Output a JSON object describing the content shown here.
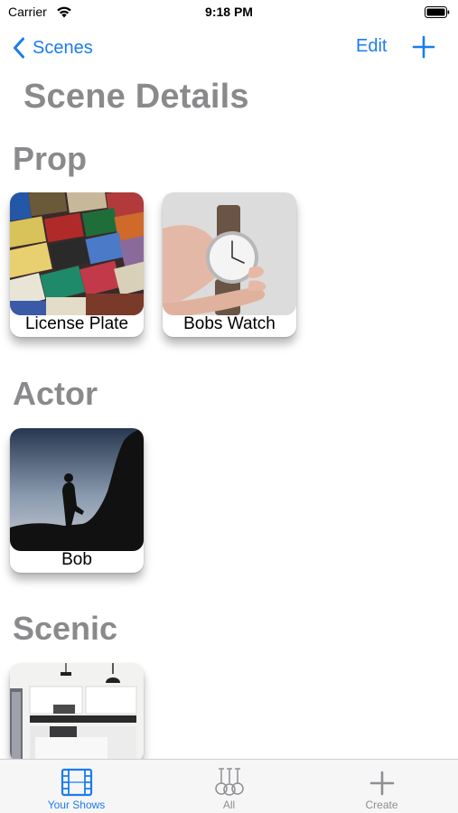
{
  "status_bar": {
    "carrier": "Carrier",
    "time": "9:18 PM"
  },
  "nav": {
    "back_label": "Scenes",
    "edit_label": "Edit"
  },
  "page_title": "Scene Details",
  "sections": [
    {
      "title": "Prop",
      "items": [
        {
          "label": "License Plate"
        },
        {
          "label": "Bobs Watch"
        }
      ]
    },
    {
      "title": "Actor",
      "items": [
        {
          "label": "Bob"
        }
      ]
    },
    {
      "title": "Scenic",
      "items": [
        {
          "label": ""
        }
      ]
    }
  ],
  "tabs": [
    {
      "label": "Your Shows",
      "icon": "film-icon",
      "active": true
    },
    {
      "label": "All",
      "icon": "guitars-icon",
      "active": false
    },
    {
      "label": "Create",
      "icon": "plus-icon",
      "active": false
    }
  ],
  "colors": {
    "accent": "#1a7cf0",
    "section_title": "#8a8a8c",
    "tab_inactive": "#8e8e93"
  }
}
